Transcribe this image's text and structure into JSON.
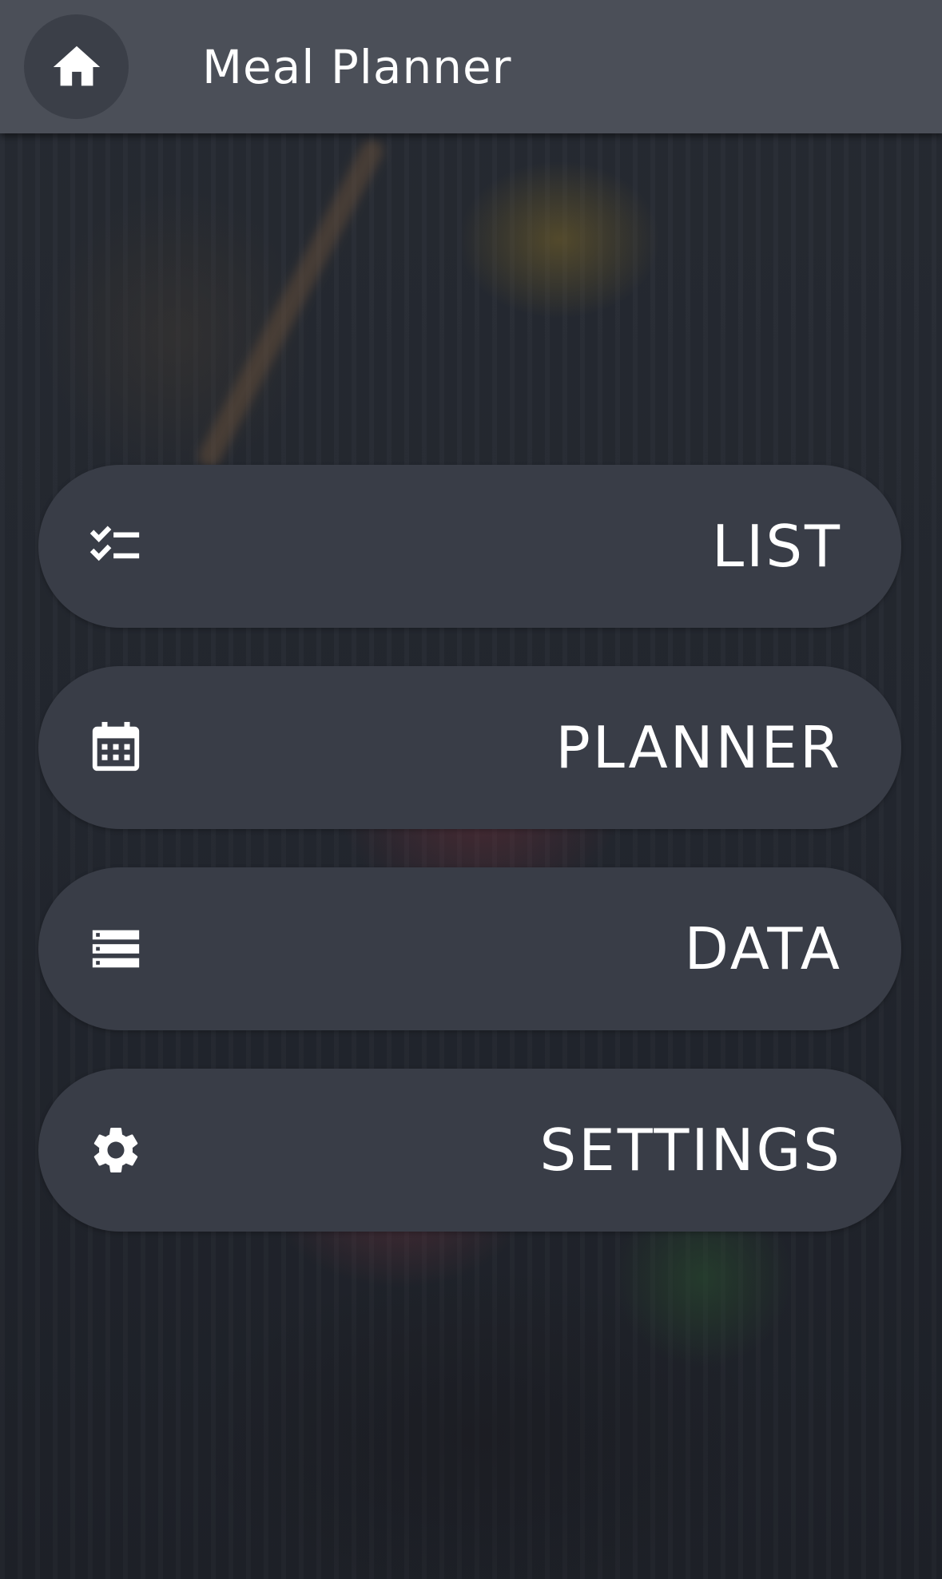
{
  "app_bar": {
    "title": "Meal Planner",
    "home_icon": "home-icon",
    "background": "#4b4f58"
  },
  "menu": {
    "items": [
      {
        "label": "LIST",
        "icon": "checklist-icon"
      },
      {
        "label": "PLANNER",
        "icon": "calendar-icon"
      },
      {
        "label": "DATA",
        "icon": "storage-icon"
      },
      {
        "label": "SETTINGS",
        "icon": "gear-icon"
      }
    ],
    "button_color": "#393d47",
    "text_color": "#ffffff"
  }
}
